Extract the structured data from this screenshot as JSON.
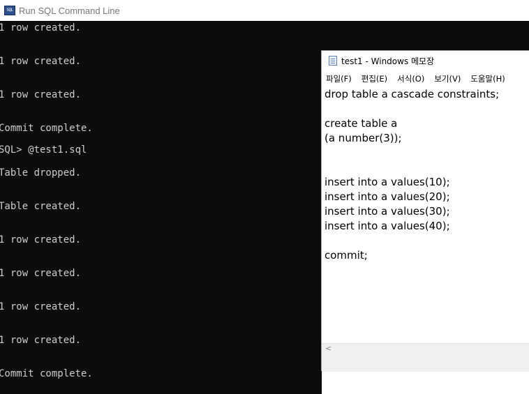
{
  "console": {
    "title": "Run SQL Command Line",
    "lines": [
      "1 row created.",
      "1 row created.",
      "1 row created.",
      "Commit complete.",
      "SQL> @test1.sql",
      "Table dropped.",
      "Table created.",
      "1 row created.",
      "1 row created.",
      "1 row created.",
      "1 row created.",
      "Commit complete."
    ]
  },
  "notepad": {
    "title": "test1 - Windows 메모장",
    "menu": [
      "파일(F)",
      "편집(E)",
      "서식(O)",
      "보기(V)",
      "도움말(H)"
    ],
    "lines": [
      "drop table a cascade constraints;",
      "",
      "create table a",
      "(a number(3));",
      "",
      "",
      "insert into a values(10);",
      "insert into a values(20);",
      "insert into a values(30);",
      "insert into a values(40);",
      "",
      "commit;"
    ],
    "scroll_left_glyph": "<"
  }
}
